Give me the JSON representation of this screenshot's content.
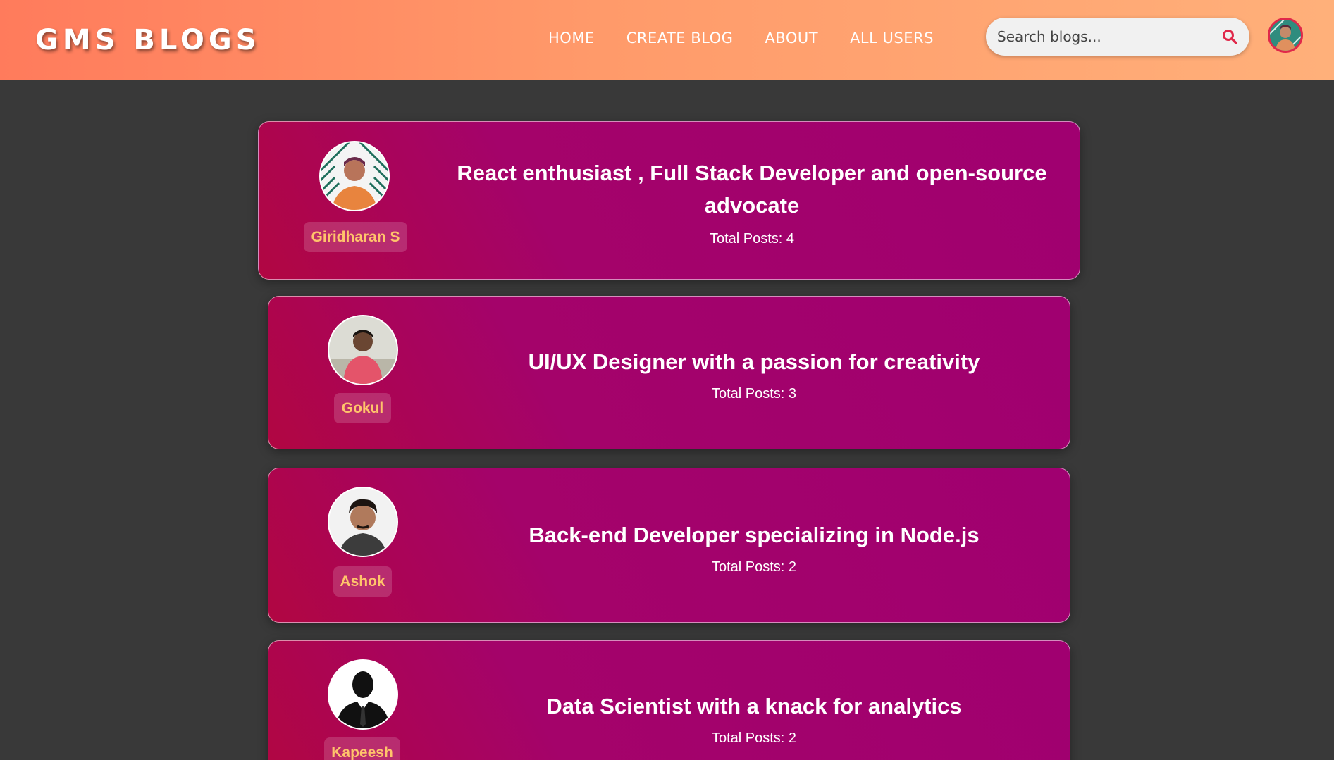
{
  "nav": {
    "brand": "GMS BLOGS",
    "links": [
      "HOME",
      "CREATE BLOG",
      "ABOUT",
      "ALL USERS"
    ],
    "search_placeholder": "Search blogs...",
    "icons": {
      "search": "search-icon",
      "profile": "user-avatar"
    },
    "colors": {
      "gradient_start": "#ff7b5c",
      "gradient_end": "#ffb07a",
      "search_icon": "#e0284a"
    }
  },
  "users": [
    {
      "name": "Giridharan S",
      "bio": "React enthusiast , Full Stack Developer and open-source advocate",
      "posts_label": "Total Posts: 4"
    },
    {
      "name": "Gokul",
      "bio": "UI/UX Designer with a passion for creativity",
      "posts_label": "Total Posts: 3"
    },
    {
      "name": "Ashok",
      "bio": "Back-end Developer specializing in Node.js",
      "posts_label": "Total Posts: 2"
    },
    {
      "name": "Kapeesh",
      "bio": "Data Scientist with a knack for analytics",
      "posts_label": "Total Posts: 2"
    }
  ],
  "colors": {
    "background": "#393939",
    "card": "#a4036a",
    "username_text": "#ffc46b"
  }
}
